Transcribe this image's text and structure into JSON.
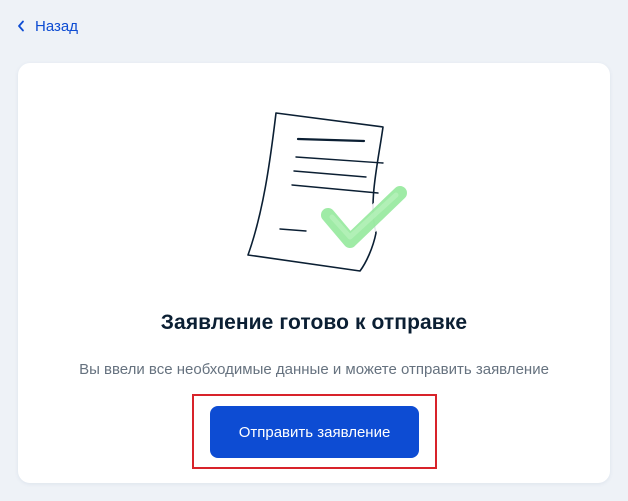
{
  "nav": {
    "back_label": "Назад",
    "back_icon": "chevron-left-icon"
  },
  "card": {
    "illustration_icon": "document-checkmark-icon",
    "title": "Заявление готово к отправке",
    "subtitle": "Вы ввели все необходимые данные и можете отправить заявление",
    "submit_label": "Отправить заявление"
  },
  "colors": {
    "page_background": "#eef2f7",
    "accent": "#0d4cd3",
    "title_text": "#0b1f33",
    "subtitle_text": "#66727f",
    "highlight_border": "#d8232a",
    "checkmark": "#7ee08a"
  }
}
